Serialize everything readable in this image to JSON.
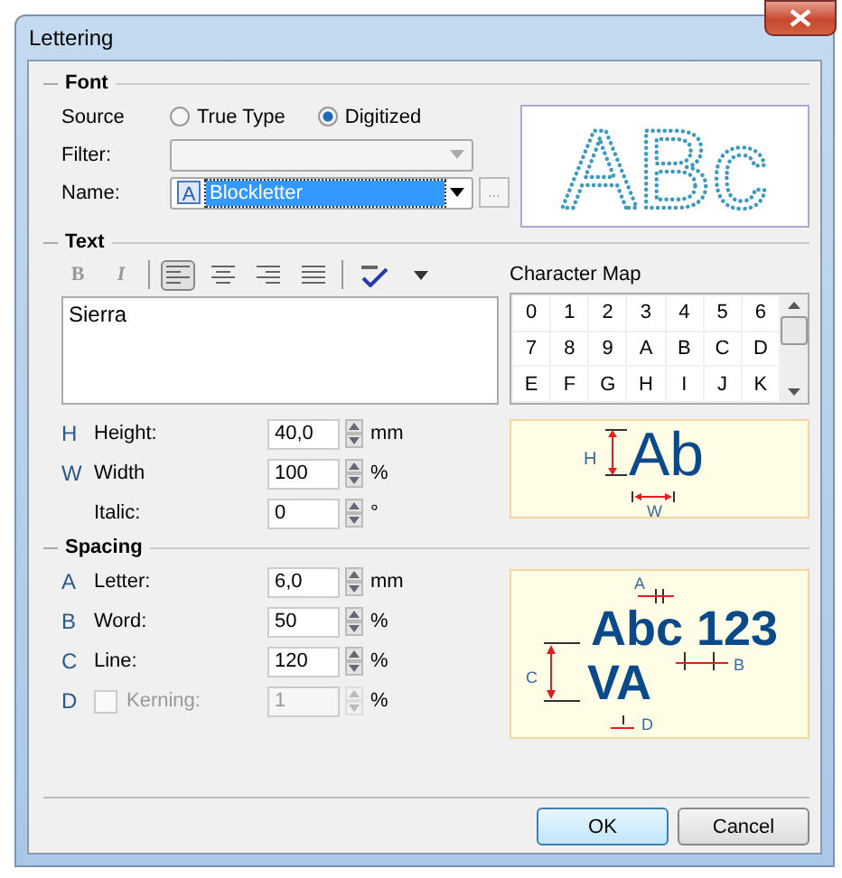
{
  "window": {
    "title": "Lettering"
  },
  "font": {
    "heading": "Font",
    "source_label": "Source",
    "sources": [
      {
        "label": "True Type",
        "selected": false
      },
      {
        "label": "Digitized",
        "selected": true
      }
    ],
    "filter_label": "Filter:",
    "name_label": "Name:",
    "name_icon_glyph": "A",
    "name_value": "Blockletter",
    "browse_button": "...",
    "preview": "ABc"
  },
  "text": {
    "heading": "Text",
    "toolbar": [
      {
        "kind": "bold",
        "label": "B",
        "selected": false,
        "disabled": true
      },
      {
        "kind": "italic",
        "label": "I",
        "selected": false,
        "disabled": true
      },
      {
        "kind": "align-left",
        "selected": true,
        "disabled": false
      },
      {
        "kind": "align-center",
        "selected": false,
        "disabled": false
      },
      {
        "kind": "align-right",
        "selected": false,
        "disabled": false
      },
      {
        "kind": "justify",
        "selected": false,
        "disabled": false
      },
      {
        "kind": "spellcheck",
        "selected": false,
        "disabled": false
      },
      {
        "kind": "dropdown",
        "selected": false,
        "disabled": false
      }
    ],
    "content": "Sierra",
    "character_map": {
      "title": "Character Map",
      "characters": [
        "0",
        "1",
        "2",
        "3",
        "4",
        "5",
        "6",
        "7",
        "8",
        "9",
        "A",
        "B",
        "C",
        "D",
        "E",
        "F",
        "G",
        "H",
        "I",
        "J",
        "K"
      ]
    },
    "fields": [
      {
        "letter": "H",
        "label": "Height:",
        "value": "40,0",
        "unit": "mm",
        "disabled": false
      },
      {
        "letter": "W",
        "label": "Width",
        "value": "100",
        "unit": "%",
        "disabled": false
      },
      {
        "label": "Italic:",
        "value": "0",
        "unit": "°",
        "disabled": false
      }
    ],
    "preview": {
      "sample": "Ab",
      "height_label": "H",
      "width_label": "W"
    }
  },
  "spacing": {
    "heading": "Spacing",
    "fields": [
      {
        "kind": "plain",
        "letter": "A",
        "label": "Letter:",
        "value": "6,0",
        "unit": "mm",
        "disabled": false
      },
      {
        "kind": "plain",
        "letter": "B",
        "label": "Word:",
        "value": "50",
        "unit": "%",
        "disabled": false
      },
      {
        "kind": "plain",
        "letter": "C",
        "label": "Line:",
        "value": "120",
        "unit": "%",
        "disabled": false
      },
      {
        "kind": "checkbox",
        "letter": "D",
        "label": "Kerning:",
        "value": "1",
        "unit": "%",
        "checked": false,
        "disabled": true
      }
    ],
    "preview": {
      "letter_label": "A",
      "line_one": "Abc 123",
      "word_label": "B",
      "line_label": "C",
      "line_two": "VA",
      "kerning_label": "D"
    }
  },
  "buttons": [
    {
      "label": "OK",
      "default": true
    },
    {
      "label": "Cancel",
      "default": false
    }
  ]
}
